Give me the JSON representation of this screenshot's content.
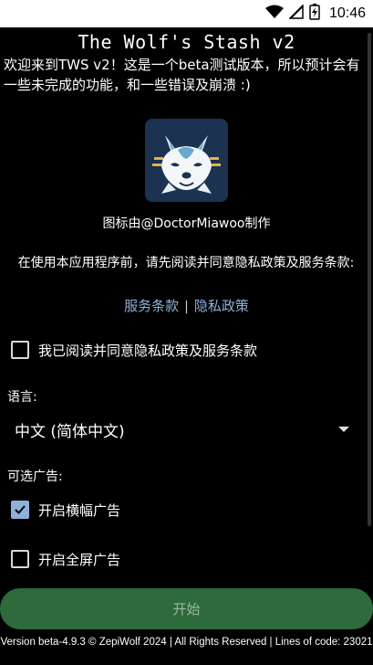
{
  "status_bar": {
    "time": "10:46",
    "icons": [
      "wifi-icon",
      "signal-icon",
      "battery-charging-icon"
    ]
  },
  "app": {
    "title": "The Wolf's Stash v2",
    "welcome": "欢迎来到TWS v2！这是一个beta测试版本，所以预计会有一些未完成的功能，和一些错误及崩溃 :)",
    "icon": "wolf-logo-icon",
    "icon_credit": "图标由@DoctorMiawoo制作",
    "notice": "在使用本应用程序前，请先阅读并同意隐私政策及服务条款:",
    "terms_link": "服务条款",
    "separator": "|",
    "privacy_link": "隐私政策",
    "agree_checkbox": {
      "label": "我已阅读并同意隐私政策及服务条款",
      "checked": false
    },
    "language": {
      "label": "语言:",
      "selected": "中文 (简体中文)"
    },
    "ads": {
      "label": "可选广告:",
      "banner": {
        "label": "开启横幅广告",
        "checked": true
      },
      "fullscreen": {
        "label": "开启全屏广告",
        "checked": false
      }
    },
    "start_button": "开始",
    "footer": "Version beta-4.9.3 © ZepiWolf 2024 | All Rights Reserved | Lines of code: 23021"
  },
  "colors": {
    "background": "#000000",
    "link": "#8fb0d8",
    "start_button": "#2d6a3c",
    "icon_bg": "#1b3250"
  }
}
